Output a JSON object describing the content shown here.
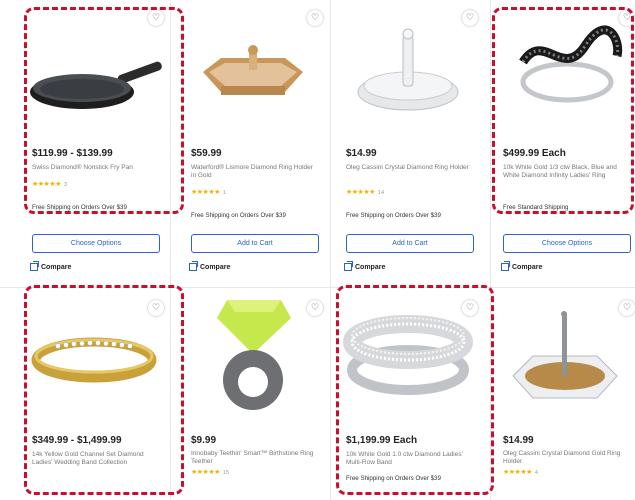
{
  "products": [
    {
      "price": "$119.99 - $139.99",
      "name": "Swiss Diamond® Nonstick Fry Pan",
      "stars": "★★★★★",
      "count": "3",
      "shipping": "Free Shipping on Orders Over $39",
      "button": "",
      "compare": ""
    },
    {
      "price": "$59.99",
      "name": "Waterford® Lismore Diamond Ring Holder in Gold",
      "stars": "★★★★★",
      "count": "1",
      "shipping": "Free Shipping on Orders Over $39",
      "button": "Add to Cart",
      "compare": "Compare"
    },
    {
      "price": "$14.99",
      "name": "Oleg Cassini Crystal Diamond Ring Holder",
      "stars": "★★★★★",
      "count": "14",
      "shipping": "Free Shipping on Orders Over $39",
      "button": "Add to Cart",
      "compare": "Compare"
    },
    {
      "price": "$499.99 Each",
      "name": "10k White Gold 1/3 ctw Black, Blue and White Diamond Infinity Ladies' Ring",
      "stars": "",
      "count": "",
      "shipping": "Free Standard Shipping",
      "button": "Choose Options",
      "compare": "Compare"
    },
    {
      "price": "$349.99 - $1,499.99",
      "name": "14k Yellow Gold Channel Set Diamond Ladies' Wedding Band Collection",
      "stars": "",
      "count": "",
      "shipping": "",
      "button": "",
      "compare": ""
    },
    {
      "price": "$9.99",
      "name": "Innobaby Teethin' Smart™ Birthstone Ring Teether",
      "stars": "★★★★★",
      "count": "15",
      "shipping": "",
      "button": "",
      "compare": ""
    },
    {
      "price": "$1,199.99 Each",
      "name": "10k White Gold 1.0 ctw Diamond Ladies' Multi-Row Band",
      "stars": "",
      "count": "",
      "shipping": "Free Shipping on Orders Over $39",
      "button": "",
      "compare": ""
    },
    {
      "price": "$14.99",
      "name": "Oleg Cassini Crystal Diamond Gold Ring Holder",
      "stars": "★★★★★",
      "count": "4",
      "shipping": "",
      "button": "",
      "compare": ""
    }
  ],
  "first_card_controls": {
    "button": "Choose Options",
    "compare": "Compare"
  },
  "colors": {
    "highlight": "#c8102e",
    "link": "#2b63c6",
    "star": "#f2b100"
  }
}
